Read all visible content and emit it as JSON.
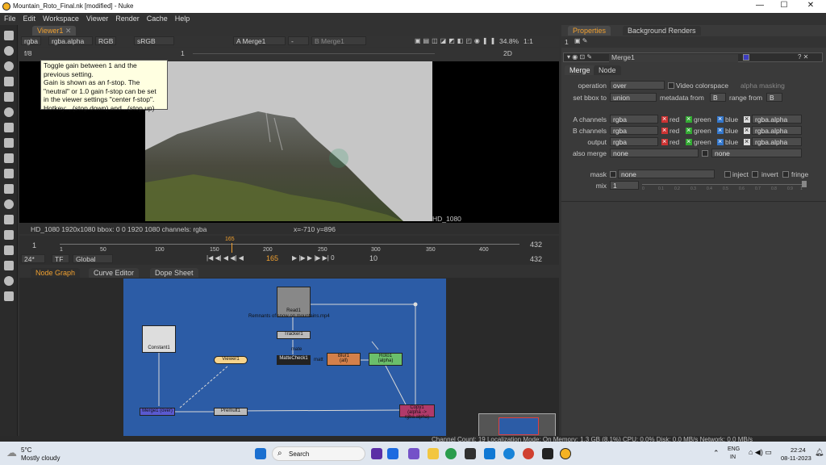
{
  "window": {
    "title": "Mountain_Roto_Final.nk [modified] - Nuke",
    "minimize": "—",
    "maximize": "☐",
    "close": "✕"
  },
  "menu": [
    "File",
    "Edit",
    "Workspace",
    "Viewer",
    "Render",
    "Cache",
    "Help"
  ],
  "viewer_tab": "Viewer1",
  "viewer_controls": {
    "channels": "rgba",
    "alpha": "rgba.alpha",
    "rgb": "RGB",
    "colorspace": "sRGB",
    "input_a": "A Merge1",
    "input_a_dash": "-",
    "input_b": "B Merge1",
    "zoom": "34.8%",
    "ratio": "1:1",
    "fstop": "f/8",
    "gain": "1",
    "y_val": "1",
    "view_mode": "2D"
  },
  "tooltip": {
    "lines": [
      "Toggle gain between 1 and the",
      "previous setting.",
      "Gain is shown as an f-stop. The",
      "\"neutral\" or 1.0 gain f-stop can be set",
      "in the viewer settings \"center f-stop\".",
      "Hotkey: , (stop down) and . (stop up)"
    ]
  },
  "viewer_format": "HD_1080",
  "status": {
    "info": "HD_1080 1920x1080  bbox: 0 0 1920 1080 channels: rgba",
    "coords": "x=-710 y=896"
  },
  "timeline": {
    "start": "1",
    "end": "432",
    "end2": "432",
    "current_marker": "165",
    "ticks": [
      "1",
      "50",
      "100",
      "150",
      "200",
      "250",
      "300",
      "350",
      "400"
    ],
    "fps": "24*",
    "tf": "TF",
    "global": "Global",
    "frame": "165",
    "step": "10"
  },
  "panel_tabs": [
    "Node Graph",
    "Curve Editor",
    "Dope Sheet"
  ],
  "nodes": {
    "read": "Read1",
    "read_sub": "Remnants of snow on mountains.mp4",
    "tracker": "Tracker1",
    "constant": "Constant1",
    "viewer": "Viewer1",
    "matte_label": "mate",
    "mattecheck": "MatteCheck1",
    "matte_short": "matt",
    "blur": "Blur1",
    "blur_sub": "(all)",
    "roto": "Roto1",
    "roto_sub": "(alpha)",
    "merge": "Merge1 (over)",
    "premult": "Premult1",
    "copy": "Copy1",
    "copy_sub": "(alpha -> rgba.alpha)"
  },
  "properties": {
    "tabs": [
      "Properties",
      "Background Renders"
    ],
    "count": "1",
    "node_name": "Merge1",
    "sub_tabs": [
      "Merge",
      "Node"
    ],
    "operation_label": "operation",
    "operation": "over",
    "video_colorspace": "Video colorspace",
    "alpha_masking": "alpha masking",
    "bbox_label": "set bbox to",
    "bbox": "union",
    "metadata_label": "metadata from",
    "metadata": "B",
    "range_label": "range from",
    "range": "B",
    "a_channels_label": "A channels",
    "a_channels": "rgba",
    "red": "red",
    "green": "green",
    "blue": "blue",
    "a_alpha": "rgba.alpha",
    "b_channels_label": "B channels",
    "b_channels": "rgba",
    "b_alpha": "rgba.alpha",
    "output_label": "output",
    "output": "rgba",
    "out_alpha": "rgba.alpha",
    "also_merge_label": "also merge",
    "also_merge": "none",
    "also_merge2": "none",
    "mask_label": "mask",
    "mask": "none",
    "inject": "inject",
    "invert": "invert",
    "fringe": "fringe",
    "mix_label": "mix",
    "mix": "1",
    "mix_ticks": [
      "0",
      "0.1",
      "0.2",
      "0.3",
      "0.4",
      "0.5",
      "0.6",
      "0.7",
      "0.8",
      "0.9",
      "1"
    ]
  },
  "bottom_status": "Channel Count: 19 Localization Mode: On Memory: 1.3 GB (8.1%) CPU: 0.0% Disk: 0.0 MB/s Network: 0.0 MB/s",
  "taskbar": {
    "weather_temp": "5°C",
    "weather_desc": "Mostly cloudy",
    "search": "Search",
    "lang1": "ENG",
    "lang2": "IN",
    "time": "22:24",
    "date": "08-11-2023"
  },
  "colors": {
    "accent": "#f0a030",
    "node_graph_bg": "#2c5ca6",
    "panel": "#3a3a3a"
  }
}
